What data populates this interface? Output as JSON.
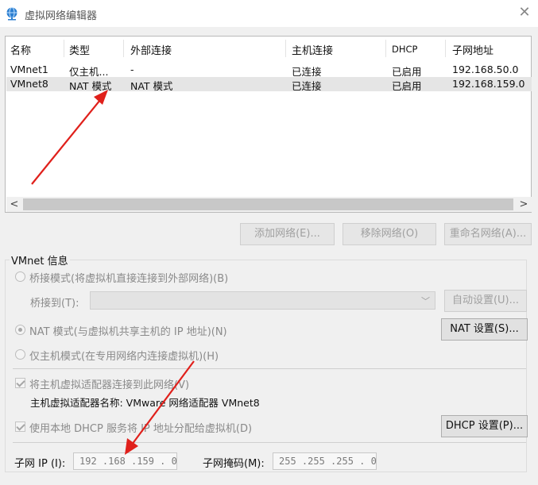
{
  "window": {
    "title": "虚拟网络编辑器",
    "close_icon": "close-icon"
  },
  "network_list": {
    "columns": [
      "名称",
      "类型",
      "外部连接",
      "主机连接",
      "DHCP",
      "子网地址"
    ],
    "rows": [
      {
        "name": "VMnet1",
        "type": "仅主机...",
        "external": "-",
        "host": "已连接",
        "dhcp": "已启用",
        "subnet": "192.168.50.0",
        "selected": false
      },
      {
        "name": "VMnet8",
        "type": "NAT 模式",
        "external": "NAT 模式",
        "host": "已连接",
        "dhcp": "已启用",
        "subnet": "192.168.159.0",
        "selected": true
      }
    ],
    "scroll_left": "<",
    "scroll_right": ">"
  },
  "list_buttons": {
    "add": "添加网络(E)...",
    "remove": "移除网络(O)",
    "rename": "重命名网络(A)..."
  },
  "vmnet_info": {
    "group_label": "VMnet 信息",
    "bridged_label": "桥接模式(将虚拟机直接连接到外部网络)(B)",
    "bridge_to_label": "桥接到(T):",
    "bridge_to_value": "",
    "auto_settings": "自动设置(U)...",
    "nat_label": "NAT 模式(与虚拟机共享主机的 IP 地址)(N)",
    "nat_settings": "NAT 设置(S)...",
    "hostonly_label": "仅主机模式(在专用网络内连接虚拟机)(H)",
    "connect_adapter_label": "将主机虚拟适配器连接到此网络(V)",
    "adapter_name_label": "主机虚拟适配器名称: VMware 网络适配器 VMnet8",
    "use_dhcp_label": "使用本地 DHCP 服务将 IP 地址分配给虚拟机(D)",
    "dhcp_settings": "DHCP 设置(P)...",
    "subnet_ip_label": "子网 IP (I):",
    "subnet_ip_value": "192 .168 .159 . 0",
    "subnet_mask_label": "子网掩码(M):",
    "subnet_mask_value": "255 .255 .255 . 0"
  },
  "annotation_color": "#e0201b"
}
